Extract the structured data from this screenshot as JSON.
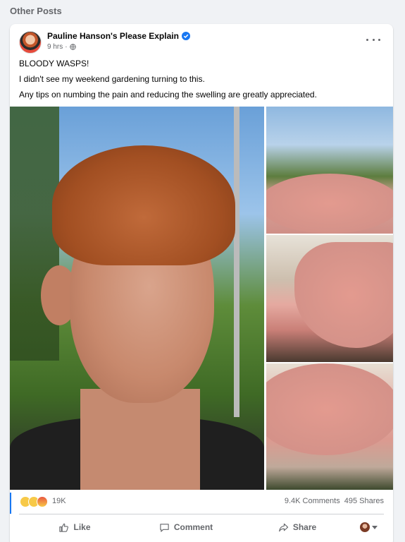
{
  "section": {
    "title": "Other Posts"
  },
  "post": {
    "author": "Pauline Hanson's Please Explain",
    "time": "9 hrs",
    "time_separator": "·",
    "lines": [
      "BLOODY WASPS!",
      "I didn't see my weekend gardening turning to this.",
      "Any tips on numbing the pain and reducing the swelling are greatly appreciated."
    ]
  },
  "stats": {
    "reactions_count": "19K",
    "comments": "9.4K Comments",
    "shares": "495 Shares",
    "reaction_types": [
      "wow",
      "care",
      "angry"
    ]
  },
  "actions": {
    "like": "Like",
    "comment": "Comment",
    "share": "Share"
  },
  "colors": {
    "accent": "#1877f2",
    "muted": "#65676b",
    "background": "#f0f2f5"
  },
  "icons": [
    "verified-badge-icon",
    "globe-icon",
    "more-options-icon",
    "like-icon",
    "comment-icon",
    "share-icon",
    "chevron-down-icon"
  ]
}
